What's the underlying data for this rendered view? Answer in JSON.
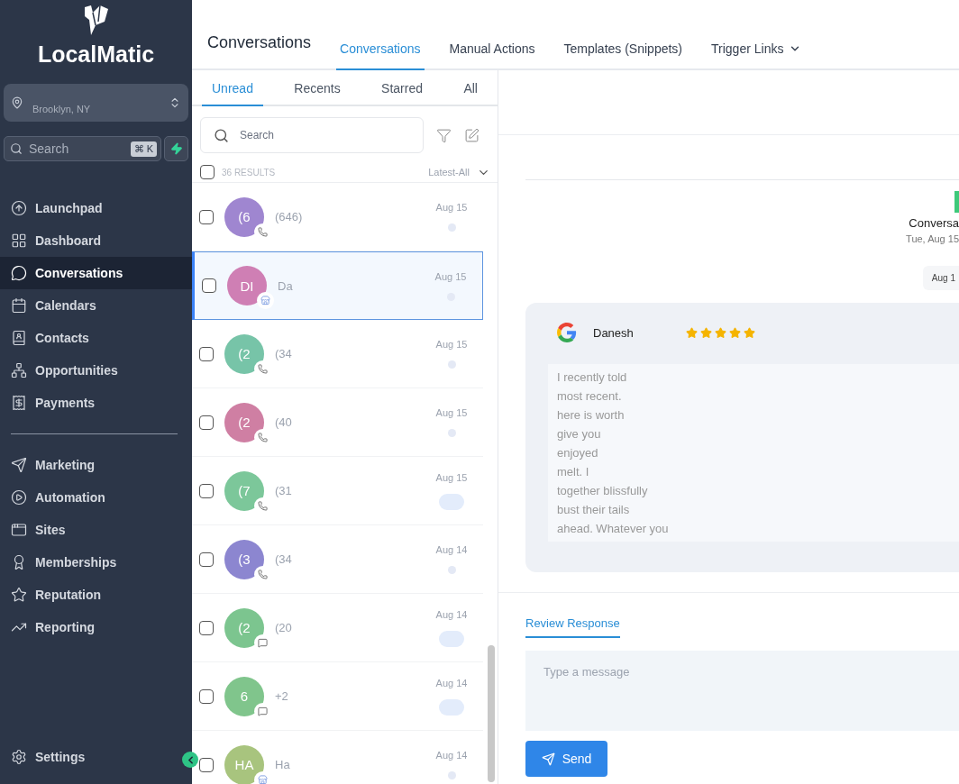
{
  "brand": {
    "name": "LocalMatic"
  },
  "location": {
    "subtitle": "Brooklyn, NY"
  },
  "sidebar_search": {
    "placeholder": "Search",
    "shortcut": "⌘ K"
  },
  "nav": {
    "main": [
      {
        "label": "Launchpad",
        "selected": false
      },
      {
        "label": "Dashboard",
        "selected": false
      },
      {
        "label": "Conversations",
        "selected": true
      },
      {
        "label": "Calendars",
        "selected": false
      },
      {
        "label": "Contacts",
        "selected": false
      },
      {
        "label": "Opportunities",
        "selected": false
      },
      {
        "label": "Payments",
        "selected": false
      }
    ],
    "secondary": [
      {
        "label": "Marketing",
        "selected": false
      },
      {
        "label": "Automation",
        "selected": false
      },
      {
        "label": "Sites",
        "selected": false
      },
      {
        "label": "Memberships",
        "selected": false
      },
      {
        "label": "Reputation",
        "selected": false
      },
      {
        "label": "Reporting",
        "selected": false
      }
    ],
    "settings": {
      "label": "Settings"
    }
  },
  "header": {
    "title": "Conversations",
    "tabs": [
      {
        "label": "Conversations",
        "selected": true
      },
      {
        "label": "Manual Actions",
        "selected": false
      },
      {
        "label": "Templates (Snippets)",
        "selected": false
      },
      {
        "label": "Trigger Links",
        "selected": false,
        "dropdown": true
      }
    ]
  },
  "list": {
    "tabs": [
      {
        "label": "Unread",
        "selected": true
      },
      {
        "label": "Recents",
        "selected": false
      },
      {
        "label": "Starred",
        "selected": false
      },
      {
        "label": "All",
        "selected": false
      }
    ],
    "search": {
      "placeholder": "Search"
    },
    "select_all": {
      "checked": false
    },
    "results": "36 RESULTS",
    "sort": "Latest-All",
    "rows": [
      {
        "initials": "(6",
        "name": "(646)",
        "date": "Aug 15",
        "kind": "phone",
        "color": "#9f86d0",
        "checked": false,
        "selected": false,
        "unread": false
      },
      {
        "initials": "DI",
        "name": "Da",
        "date": "Aug 15",
        "kind": "review",
        "color": "#cf7fb4",
        "checked": false,
        "selected": true,
        "unread": false
      },
      {
        "initials": "(2",
        "name": "(34",
        "date": "Aug 15",
        "kind": "phone",
        "color": "#77c4a8",
        "checked": false,
        "selected": false,
        "unread": false
      },
      {
        "initials": "(2",
        "name": "(40",
        "date": "Aug 15",
        "kind": "phone",
        "color": "#cf7fa3",
        "checked": false,
        "selected": false,
        "unread": false
      },
      {
        "initials": "(7",
        "name": "(31",
        "date": "Aug 15",
        "kind": "phone",
        "color": "#7cc79a",
        "checked": false,
        "selected": false,
        "unread": true
      },
      {
        "initials": "(3",
        "name": "(34",
        "date": "Aug 14",
        "kind": "phone",
        "color": "#8c86d0",
        "checked": false,
        "selected": false,
        "unread": false
      },
      {
        "initials": "(2",
        "name": "(20",
        "date": "Aug 14",
        "kind": "sms",
        "color": "#7cc58f",
        "checked": false,
        "selected": false,
        "unread": true
      },
      {
        "initials": "6",
        "name": "+2",
        "date": "Aug 14",
        "kind": "sms",
        "color": "#80c58c",
        "checked": false,
        "selected": false,
        "unread": true
      },
      {
        "initials": "HA",
        "name": "Ha",
        "date": "Aug 14",
        "kind": "review",
        "color": "#a8c47e",
        "checked": false,
        "selected": false,
        "unread": false
      }
    ]
  },
  "conversation": {
    "title": "Conversa",
    "date": "Tue, Aug 15",
    "chip": "Aug 1",
    "review": {
      "name": "Danesh",
      "stars": 5,
      "lines": [
        "I recently told",
        "most recent.",
        "here is worth",
        "give you",
        "enjoyed",
        "melt. I",
        "together blissfully",
        "bust their tails",
        "ahead. Whatever you"
      ]
    },
    "reply_tabs": [
      {
        "label": "Review Response",
        "selected": true
      }
    ],
    "message": {
      "placeholder": "Type a message"
    },
    "send": "Send"
  }
}
